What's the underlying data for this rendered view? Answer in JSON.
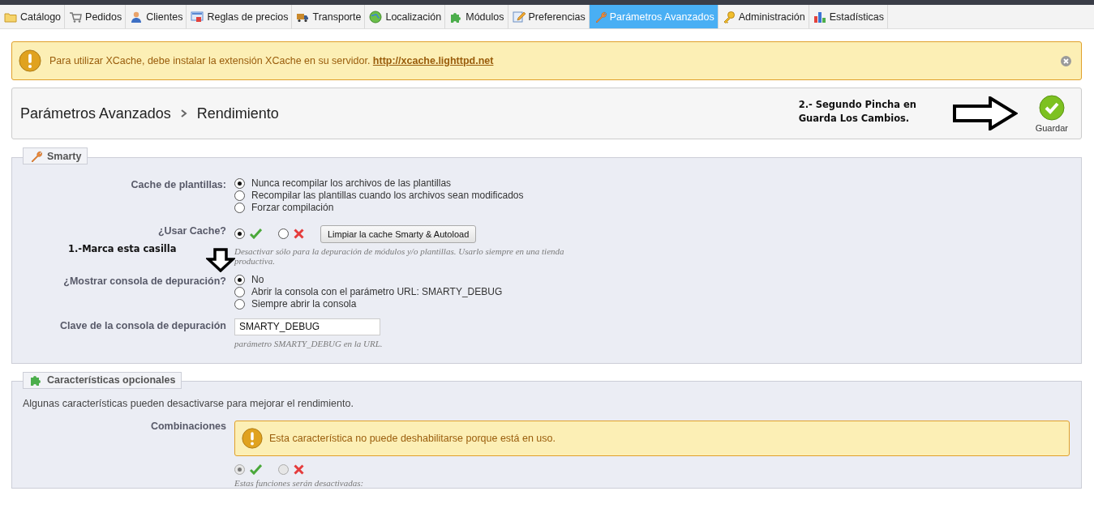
{
  "tabs": [
    {
      "label": "Catálogo",
      "selected": false
    },
    {
      "label": "Pedidos",
      "selected": false
    },
    {
      "label": "Clientes",
      "selected": false
    },
    {
      "label": "Reglas de precios",
      "selected": false
    },
    {
      "label": "Transporte",
      "selected": false
    },
    {
      "label": "Localización",
      "selected": false
    },
    {
      "label": "Módulos",
      "selected": false
    },
    {
      "label": "Preferencias",
      "selected": false
    },
    {
      "label": "Parámetros Avanzados",
      "selected": true
    },
    {
      "label": "Administración",
      "selected": false
    },
    {
      "label": "Estadísticas",
      "selected": false
    }
  ],
  "alert": {
    "text": "Para utilizar XCache, debe instalar la extensión XCache en su servidor.",
    "link": "http://xcache.lighttpd.net"
  },
  "toolbar": {
    "breadcrumb": [
      "Parámetros Avanzados",
      "Rendimiento"
    ],
    "note": "2.- Segundo Pincha en Guarda Los Cambios.",
    "save": "Guardar"
  },
  "smarty": {
    "legend": "Smarty",
    "note": "1.-Marca esta casilla",
    "fields": [
      {
        "kind": "radio",
        "label": "Cache de plantillas:",
        "options": [
          {
            "label": "Nunca recompilar los archivos de las plantillas",
            "selected": true
          },
          {
            "label": "Recompilar las plantillas cuando los archivos sean modificados",
            "selected": false
          },
          {
            "label": "Forzar compilación",
            "selected": false
          }
        ]
      },
      {
        "kind": "yesno",
        "label": "¿Usar Cache?",
        "options": [
          {
            "kind": "yes",
            "selected": true
          },
          {
            "kind": "no",
            "selected": false
          }
        ],
        "button": "Limpiar la cache Smarty & Autoload",
        "help": "Desactivar sólo para la depuración de módulos y/o plantillas. Usarlo siempre en una tienda productiva.",
        "disabled": false
      },
      {
        "kind": "radio",
        "label": "¿Mostrar consola de depuración?",
        "options": [
          {
            "label": "No",
            "selected": true
          },
          {
            "label": "Abrir la consola con el parámetro URL: SMARTY_DEBUG",
            "selected": false
          },
          {
            "label": "Siempre abrir la consola",
            "selected": false
          }
        ]
      },
      {
        "kind": "input",
        "label": "Clave de la consola de depuración",
        "value": "SMARTY_DEBUG",
        "help": "parámetro SMARTY_DEBUG en la URL."
      }
    ]
  },
  "optional": {
    "legend": "Características opcionales",
    "intro": "Algunas características pueden desactivarse para mejorar el rendimiento.",
    "fields": [
      {
        "kind": "yesno",
        "label": "Combinaciones",
        "alert": "Esta característica no puede deshabilitarse porque está en uso.",
        "options": [
          {
            "kind": "yes",
            "selected": true
          },
          {
            "kind": "no",
            "selected": false
          }
        ],
        "help": "Estas funciones serán desactivadas:",
        "disabled": true
      }
    ]
  }
}
